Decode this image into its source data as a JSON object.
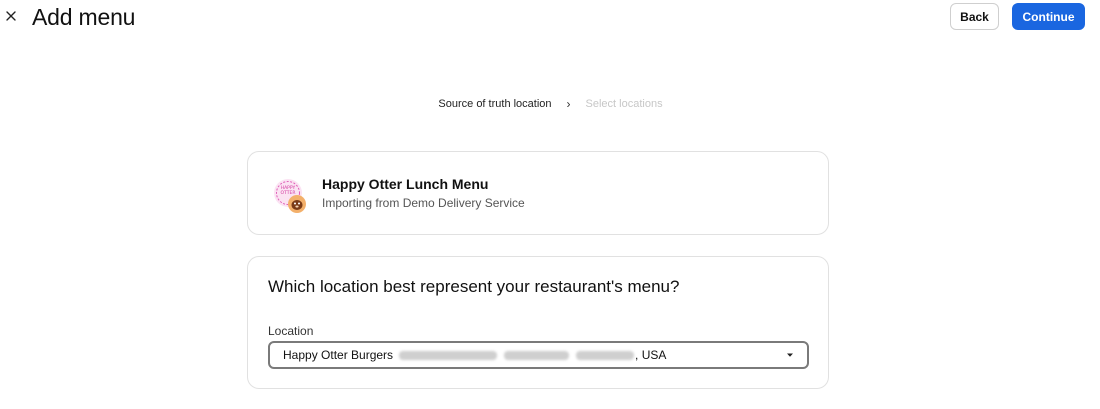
{
  "header": {
    "title": "Add menu",
    "back_label": "Back",
    "continue_label": "Continue"
  },
  "stepper": {
    "steps": [
      {
        "label": "Source of truth location",
        "active": true
      },
      {
        "label": "Select locations",
        "active": false
      }
    ]
  },
  "menu_card": {
    "title": "Happy Otter Lunch Menu",
    "subtitle": "Importing from Demo Delivery Service",
    "logo_icon": "happy-otter-logo"
  },
  "location_card": {
    "question": "Which location best represent your restaurant's menu?",
    "field_label": "Location",
    "selected_name": "Happy Otter Burgers",
    "selected_country": ", USA"
  },
  "colors": {
    "primary": "#1a66e0",
    "border": "#e1e1e1",
    "select_border": "#7a7a7a"
  }
}
